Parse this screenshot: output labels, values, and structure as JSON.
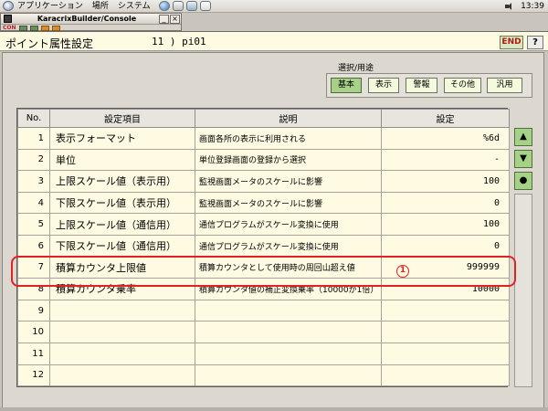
{
  "top_panel": {
    "menus": [
      "アプリケーション",
      "場所",
      "システム"
    ],
    "clock": "13:39"
  },
  "mini_window": {
    "title": "KaracrixBuilder/Console",
    "toolbar_con": "CON",
    "minimize": "_",
    "close": "×"
  },
  "header": {
    "title": "ポイント属性設定",
    "point_id": "11 ) pi01",
    "end_label": "END",
    "help_label": "?"
  },
  "category": {
    "label": "選択/用途",
    "buttons": [
      "基本",
      "表示",
      "警報",
      "その他",
      "汎用"
    ],
    "active": "基本"
  },
  "table": {
    "headers": [
      "No.",
      "設定項目",
      "説明",
      "設定"
    ],
    "rows": [
      {
        "no": "1",
        "item": "表示フォーマット",
        "desc": "画面各所の表示に利用される",
        "value": "%6d"
      },
      {
        "no": "2",
        "item": "単位",
        "desc": "単位登録画面の登録から選択",
        "value": "-"
      },
      {
        "no": "3",
        "item": "上限スケール値（表示用）",
        "desc": "監視画面メータのスケールに影響",
        "value": "100"
      },
      {
        "no": "4",
        "item": "下限スケール値（表示用）",
        "desc": "監視画面メータのスケールに影響",
        "value": "0"
      },
      {
        "no": "5",
        "item": "上限スケール値（通信用）",
        "desc": "通信プログラムがスケール変換に使用",
        "value": "100"
      },
      {
        "no": "6",
        "item": "下限スケール値（通信用）",
        "desc": "通信プログラムがスケール変換に使用",
        "value": "0"
      },
      {
        "no": "7",
        "item": "積算カウンタ上限値",
        "desc": "積算カウンタとして使用時の周回山超え値",
        "value": "999999"
      },
      {
        "no": "8",
        "item": "積算カウンタ乗率",
        "desc": "積算カウンタ値の補正変換乗率（10000が1倍）",
        "value": "10000"
      },
      {
        "no": "9",
        "item": "",
        "desc": "",
        "value": ""
      },
      {
        "no": "10",
        "item": "",
        "desc": "",
        "value": ""
      },
      {
        "no": "11",
        "item": "",
        "desc": "",
        "value": ""
      },
      {
        "no": "12",
        "item": "",
        "desc": "",
        "value": ""
      }
    ]
  },
  "scroll": {
    "up": "▲",
    "down": "▼",
    "dot": "●"
  },
  "annotation": {
    "marker": "1"
  },
  "colors": {
    "panel_bg": "#fffbe2",
    "active_green": "#a9d08a",
    "highlight_red": "#e02222"
  }
}
